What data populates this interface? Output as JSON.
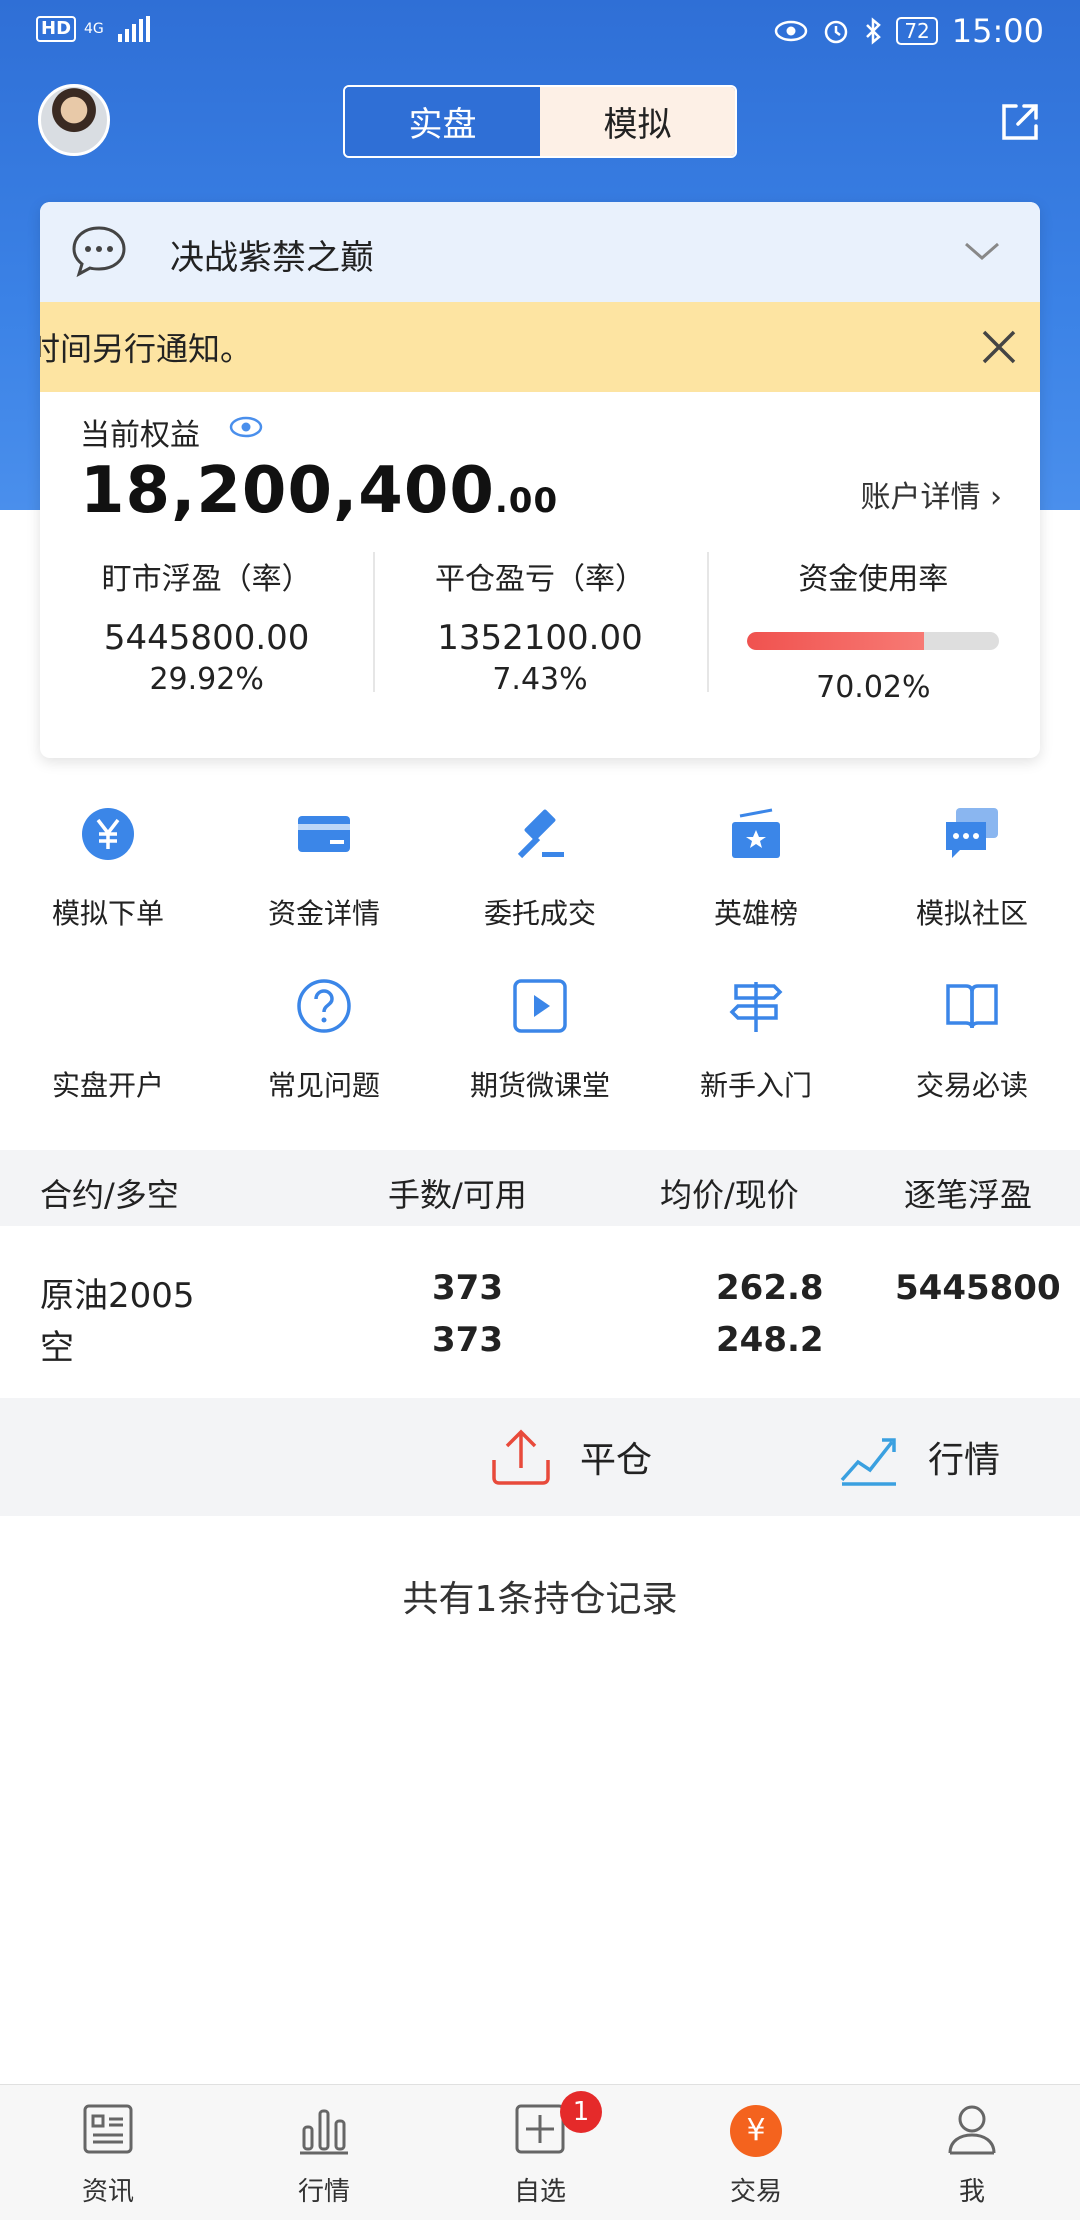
{
  "status_bar": {
    "hd": "HD",
    "network": "4G",
    "battery": "72",
    "time": "15:00"
  },
  "header": {
    "tabs": [
      {
        "label": "实盘",
        "active": true
      },
      {
        "label": "模拟",
        "active": false
      }
    ]
  },
  "card": {
    "group_name": "决战紫禁之巅",
    "notice": "时间另行通知。",
    "equity_label": "当前权益",
    "equity_int": "18,200,400",
    "equity_dec": ".00",
    "account_detail": "账户详情 ›",
    "stats": [
      {
        "label": "盯市浮盈（率）",
        "value": "5445800.00",
        "rate": "29.92%"
      },
      {
        "label": "平仓盈亏（率）",
        "value": "1352100.00",
        "rate": "7.43%"
      }
    ],
    "usage": {
      "label": "资金使用率",
      "rate": "70.02%",
      "fraction": 0.7002
    }
  },
  "menu": [
    {
      "label": "模拟下单",
      "icon": "yen-icon"
    },
    {
      "label": "资金详情",
      "icon": "card-icon"
    },
    {
      "label": "委托成交",
      "icon": "gavel-icon"
    },
    {
      "label": "英雄榜",
      "icon": "trophy-icon"
    },
    {
      "label": "模拟社区",
      "icon": "chat-icon"
    },
    {
      "label": "实盘开户",
      "icon": ""
    },
    {
      "label": "常见问题",
      "icon": "question-icon"
    },
    {
      "label": "期货微课堂",
      "icon": "play-icon"
    },
    {
      "label": "新手入门",
      "icon": "signpost-icon"
    },
    {
      "label": "交易必读",
      "icon": "book-icon"
    }
  ],
  "table": {
    "headers": [
      "合约/多空",
      "手数/可用",
      "均价/现价",
      "逐笔浮盈"
    ],
    "row": {
      "contract": "原油2005",
      "direction": "空",
      "lots": "373",
      "available": "373",
      "avg_price": "262.8",
      "cur_price": "248.2",
      "float_pnl": "5445800"
    }
  },
  "actions": {
    "close": "平仓",
    "quote": "行情"
  },
  "records": "共有1条持仓记录",
  "bottom_nav": [
    {
      "label": "资讯"
    },
    {
      "label": "行情"
    },
    {
      "label": "自选",
      "badge": "1"
    },
    {
      "label": "交易",
      "symbol": "¥"
    },
    {
      "label": "我"
    }
  ],
  "colors": {
    "primary": "#2f6fd6",
    "notice_bg": "#fde4a2",
    "usage_fill": "#f0524f",
    "trade_accent": "#f4631e",
    "badge": "#e52a2a"
  }
}
